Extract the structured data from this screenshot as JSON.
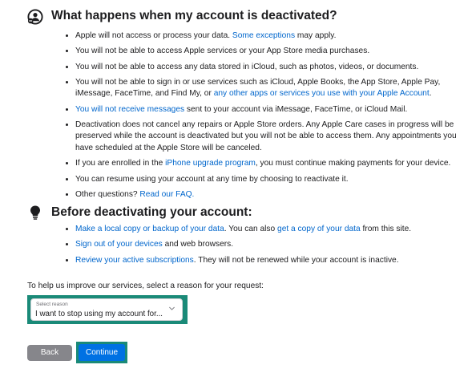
{
  "deactivation": {
    "title": "What happens when my account is deactivated?",
    "icon": "account-deactivate-icon",
    "items": [
      [
        {
          "t": "Apple will not access or process your data. "
        },
        {
          "t": "Some exceptions",
          "link": true
        },
        {
          "t": " may apply."
        }
      ],
      [
        {
          "t": "You will not be able to access Apple services or your App Store media purchases."
        }
      ],
      [
        {
          "t": "You will not be able to access any data stored in iCloud, such as photos, videos, or documents."
        }
      ],
      [
        {
          "t": "You will not be able to sign in or use services such as iCloud, Apple Books, the App Store, Apple Pay, iMessage, FaceTime, and Find My, or "
        },
        {
          "t": "any other apps or services you use with your Apple Account",
          "link": true
        },
        {
          "t": "."
        }
      ],
      [
        {
          "t": "You will not receive messages",
          "link": true
        },
        {
          "t": " sent to your account via iMessage, FaceTime, or iCloud Mail."
        }
      ],
      [
        {
          "t": "Deactivation does not cancel any repairs or Apple Store orders. Any Apple Care cases in progress will be preserved while the account is deactivated but you will not be able to access them. Any appointments you have scheduled at the Apple Store will be canceled."
        }
      ],
      [
        {
          "t": "If you are enrolled in the "
        },
        {
          "t": "iPhone upgrade program",
          "link": true
        },
        {
          "t": ", you must continue making payments for your device."
        }
      ],
      [
        {
          "t": "You can resume using your account at any time by choosing to reactivate it."
        }
      ],
      [
        {
          "t": "Other questions? "
        },
        {
          "t": "Read our FAQ.",
          "link": true
        }
      ]
    ]
  },
  "before": {
    "title": "Before deactivating your account:",
    "icon": "lightbulb-icon",
    "items": [
      [
        {
          "t": "Make a local copy or backup of your data",
          "link": true
        },
        {
          "t": ". You can also "
        },
        {
          "t": "get a copy of your data",
          "link": true
        },
        {
          "t": " from this site."
        }
      ],
      [
        {
          "t": "Sign out of your devices",
          "link": true
        },
        {
          "t": " and web browsers."
        }
      ],
      [
        {
          "t": "Review your active subscriptions",
          "link": true
        },
        {
          "t": ". They will not be renewed while your account is inactive."
        }
      ]
    ]
  },
  "reason": {
    "prompt": "To help us improve our services, select a reason for your request:",
    "select_caption": "Select reason",
    "select_value": "I want to stop using my account for...",
    "chevron_icon": "chevron-down-icon"
  },
  "buttons": {
    "back": "Back",
    "continue": "Continue"
  },
  "colors": {
    "link": "#0066cc",
    "highlight": "#1a8a78",
    "primary": "#0071e3",
    "secondary": "#86868b"
  }
}
